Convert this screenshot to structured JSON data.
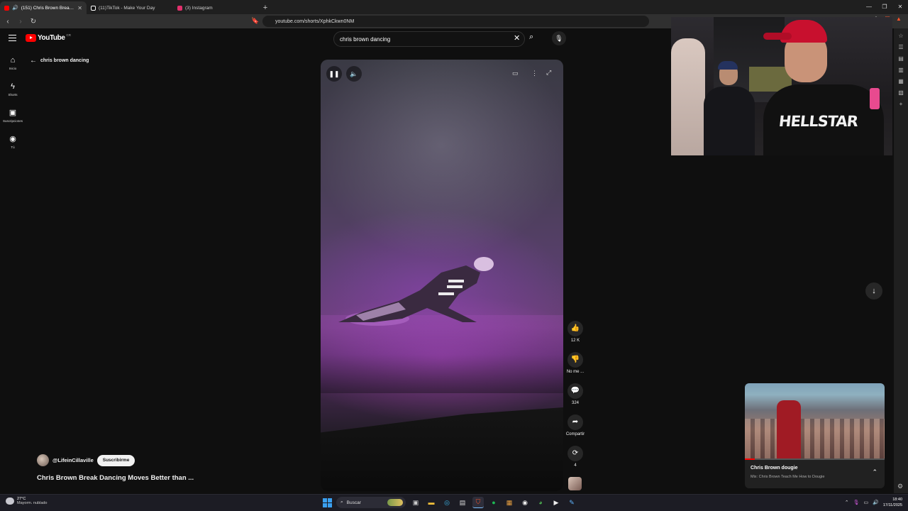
{
  "browser": {
    "tabs": [
      {
        "title": "(151) Chris Brown Break Dancing",
        "active": true,
        "favicon_color": "#ff0000"
      },
      {
        "title": "(11)TikTok - Make Your Day",
        "active": false,
        "favicon_color": "#ffffff"
      },
      {
        "title": "(3) Instagram",
        "active": false,
        "favicon_color": "#e1306c"
      }
    ],
    "new_tab": "+",
    "url": "youtube.com/shorts/XphkCkwn0NM",
    "brave_badge": "4"
  },
  "youtube": {
    "logo_text": "YouTube",
    "country_code": "CR",
    "search_value": "chris brown dancing",
    "sidebar": [
      {
        "label": "Inicio",
        "icon": "home-icon",
        "glyph": "⌂"
      },
      {
        "label": "Shorts",
        "icon": "shorts-icon",
        "glyph": "ϟ"
      },
      {
        "label": "Suscripciones",
        "icon": "subscriptions-icon",
        "glyph": "▣"
      },
      {
        "label": "Tú",
        "icon": "you-icon",
        "glyph": "◉"
      }
    ],
    "back_label": "chris brown dancing",
    "actions": [
      {
        "name": "like",
        "glyph": "👍",
        "label": "12 K"
      },
      {
        "name": "dislike",
        "glyph": "👎",
        "label": "No me ..."
      },
      {
        "name": "comments",
        "glyph": "💬",
        "label": "324"
      },
      {
        "name": "share",
        "glyph": "➦",
        "label": "Compartir"
      },
      {
        "name": "remix",
        "glyph": "⟳",
        "label": "4"
      }
    ],
    "channel": "@LifeinCillaville",
    "subscribe_label": "Suscribirme",
    "video_title": "Chris Brown Break Dancing Moves Better than ...",
    "mini_player": {
      "title": "Chris Brown dougie",
      "subtitle": "Mix: Chris Brown Teach Me How to Dougie"
    }
  },
  "webcam": {
    "shirt_text": "HELLSTAR"
  },
  "taskbar": {
    "weather_temp": "27°C",
    "weather_desc": "Mayorm. nublado",
    "search_label": "Buscar",
    "time": "18:40",
    "date": "17/11/2025"
  }
}
